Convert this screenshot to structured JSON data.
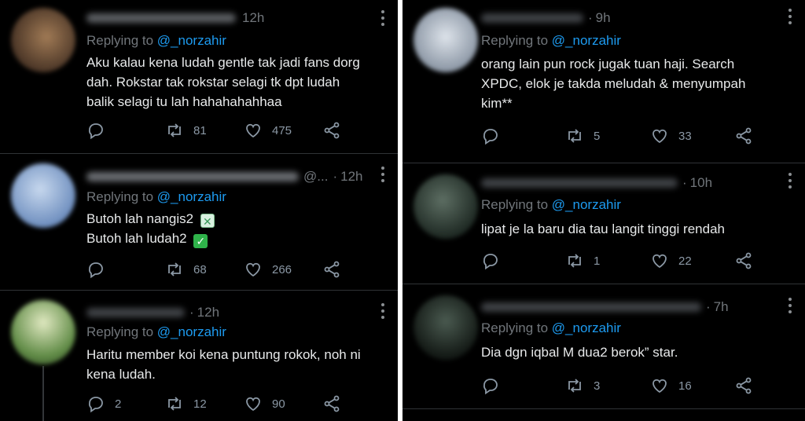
{
  "left_column": [
    {
      "time": "12h",
      "reply_prefix": "Replying to",
      "reply_handle": "@_norzahir",
      "lines": [
        "Aku kalau kena ludah gentle tak jadi fans dorg",
        "dah. Rokstar tak rokstar selagi tk dpt ludah",
        "balik selagi tu lah hahahahahhaa"
      ],
      "stats": {
        "replies": "",
        "retweets": "81",
        "likes": "475"
      },
      "icons": [
        "reply-icon",
        "retweet-icon",
        "like-icon",
        "share-icon"
      ],
      "avatar_color": "#6b5240"
    },
    {
      "time": "12h",
      "name_suffix": "@...",
      "reply_prefix": "Replying to",
      "reply_handle": "@_norzahir",
      "lines": [
        "Butoh lah nangis2",
        "Butoh lah ludah2"
      ],
      "marks": [
        "✕",
        "✓"
      ],
      "stats": {
        "replies": "",
        "retweets": "68",
        "likes": "266"
      },
      "avatar_color": "#8aa6cf"
    },
    {
      "time": "12h",
      "reply_prefix": "Replying to",
      "reply_handle": "@_norzahir",
      "lines": [
        "Haritu member koi kena puntung rokok, noh ni",
        "kena ludah."
      ],
      "stats": {
        "replies": "2",
        "retweets": "12",
        "likes": "90"
      },
      "avatar_color": "#7b9a6a"
    }
  ],
  "right_column": [
    {
      "time": "9h",
      "reply_prefix": "Replying to",
      "reply_handle": "@_norzahir",
      "lines": [
        "orang lain pun rock jugak tuan haji. Search",
        "XPDC, elok je takda meludah & menyumpah",
        "kim**"
      ],
      "stats": {
        "replies": "",
        "retweets": "5",
        "likes": "33"
      },
      "avatar_color": "#b8c0c8"
    },
    {
      "time": "10h",
      "reply_prefix": "Replying to",
      "reply_handle": "@_norzahir",
      "lines": [
        "lipat je la baru dia tau langit tinggi rendah"
      ],
      "stats": {
        "replies": "",
        "retweets": "1",
        "likes": "22"
      },
      "avatar_color": "#3a4a40"
    },
    {
      "time": "7h",
      "reply_prefix": "Replying to",
      "reply_handle": "@_norzahir",
      "lines": [
        "Dia dgn iqbal M dua2 berok” star."
      ],
      "stats": {
        "replies": "",
        "retweets": "3",
        "likes": "16"
      },
      "avatar_color": "#2e3a34"
    }
  ]
}
